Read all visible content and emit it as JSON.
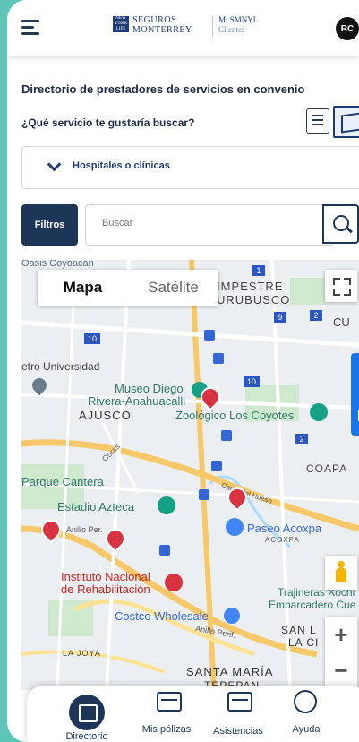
{
  "header": {
    "logo_badge": "NEW YORK LIFE",
    "brand_line1": "SEGUROS",
    "brand_line2": "MONTERREY",
    "app_line1": "Mi SMNYL",
    "app_line2": "Clientes",
    "avatar_initials": "RC"
  },
  "page": {
    "title": "Directorio de prestadores de servicios en convenio",
    "question": "¿Qué servicio te gustaría buscar?"
  },
  "filter": {
    "selected_service": "Hospitales o clínicas",
    "filters_button": "Filtros",
    "search_placeholder": "Buscar"
  },
  "map": {
    "type_controls": [
      "Mapa",
      "Satélite"
    ],
    "active_type": "Mapa",
    "labels": {
      "l1": "Oasis Coyoacán",
      "l2": "IMPESTRE",
      "l3": "URUBUSCO",
      "l4": "CU",
      "l5": "etro Universidad",
      "l6": "Museo Diego",
      "l7": "Rivera-Anahuacalli",
      "l8": "AJUSCO",
      "l9": "Zoológico Los Coyotes",
      "l10": "Coras",
      "l11": "COAPA",
      "l12": "Parque Cantera",
      "l13": "Canal del Hueso",
      "l14": "Estadio Azteca",
      "l15": "Anillo Per.",
      "l16": "Paseo Acoxpa",
      "l17": "ACOXPA",
      "l18": "Instituto Nacional",
      "l19": "de Rehabilitación",
      "l20": "Trajineras Xochi",
      "l21": "Embarcadero Cue",
      "l22": "Costco Wholesale",
      "l23": "Anillo Perif.",
      "l24": "SAN L",
      "l25": "LA CI",
      "l26": "LA JOYA",
      "l27": "SANTA MARÍA",
      "l28": "TEPEPAN"
    },
    "route_shields": [
      "1",
      "9",
      "2",
      "10",
      "10",
      "2"
    ],
    "zoom_in": "+",
    "zoom_out": "−",
    "side_tab_icon": "list-icon"
  },
  "bottom_nav": {
    "items": [
      {
        "label": "Directorio",
        "icon": "directory-icon",
        "active": true
      },
      {
        "label": "Mis pólizas",
        "icon": "card-icon",
        "active": false
      },
      {
        "label": "Asistencias",
        "icon": "assistance-icon",
        "active": false
      },
      {
        "label": "Ayuda",
        "icon": "help-icon",
        "active": false
      }
    ]
  },
  "colors": {
    "primary": "#1d3557",
    "brand_blue": "#1f3b73",
    "pin_red": "#d93240",
    "background_teal": "#5ec6b9",
    "park_green": "#c8e6c9"
  }
}
